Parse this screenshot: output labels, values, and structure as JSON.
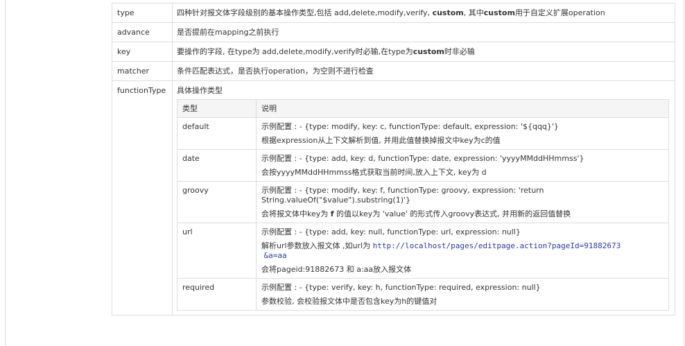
{
  "rows": {
    "type": {
      "key": "type",
      "desc_a": "四种针对报文体字段级别的基本操作类型,包括 add,delete,modify,verify, ",
      "desc_b": "custom",
      "desc_c": ", 其中",
      "desc_d": "custom",
      "desc_e": "用于自定义扩展operation"
    },
    "advance": {
      "key": "advance",
      "desc": "是否提前在mapping之前执行"
    },
    "key": {
      "key": "key",
      "desc_a": "要操作的字段, 在type为 add,delete,modify,verify时必输,在type为",
      "desc_b": "custom",
      "desc_c": "时非必输"
    },
    "matcher": {
      "key": "matcher",
      "desc": "条件匹配表达式，是否执行operation，为空则不进行检查"
    },
    "functionType": {
      "key": "functionType",
      "desc": "具体操作类型"
    }
  },
  "ft_table": {
    "headers": [
      "类型",
      "说明"
    ],
    "default": {
      "type": "default",
      "example": "示例配置 : - {type: modify, key: c, functionType: default, expression: '${qqq}'}",
      "desc": "根据expression从上下文解析到值, 并用此值替换掉报文中key为c的值"
    },
    "date": {
      "type": "date",
      "example": "示例配置 : - {type: add, key: d, functionType: date, expression: 'yyyyMMddHHmmss'}",
      "desc": "会按yyyyMMddHHmmss格式获取当前时间,放入上下文, key为 d"
    },
    "groovy": {
      "type": "groovy",
      "example_1": "示例配置 : - {type: modify, key: f, functionType: groovy, expression: 'return",
      "example_2": "String.valueOf(\"$value\").substring(1)'}",
      "desc_a": "会将报文体中key为 ",
      "desc_b": "f",
      "desc_c": " 的值以key为 'value' 的形式传入groovy表达式, 并用新的返回值替换"
    },
    "url": {
      "type": "url",
      "example": "示例配置 : - {type: add, key: null, functionType: url, expression: null}",
      "desc_prefix": "解析url参数放入报文体 ,如url为 ",
      "link_1": "http://localhost/pages/editpage.action?pageId=91882673",
      "link_2": "&a=aa",
      "desc_2": "会将pageid:91882673 和 a:aa放入报文体"
    },
    "required": {
      "type": "required",
      "example": "示例配置 : - {type: verify, key: h, functionType: required, expression: null}",
      "desc": "参数校验, 会校验报文体中是否包含key为h的键值对"
    }
  }
}
